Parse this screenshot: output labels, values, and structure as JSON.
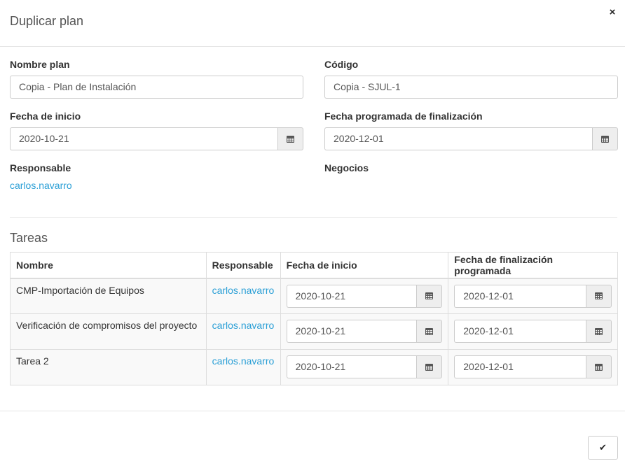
{
  "dialog": {
    "title": "Duplicar plan",
    "close_icon": "close-icon",
    "close_glyph": "×"
  },
  "form": {
    "plan_name_label": "Nombre plan",
    "plan_name_value": "Copia - Plan de Instalación",
    "code_label": "Código",
    "code_value": "Copia - SJUL-1",
    "start_date_label": "Fecha de inicio",
    "start_date_value": "2020-10-21",
    "end_date_label": "Fecha programada de finalización",
    "end_date_value": "2020-12-01",
    "responsible_label": "Responsable",
    "responsible_value": "carlos.navarro",
    "business_label": "Negocios"
  },
  "tasks": {
    "title": "Tareas",
    "columns": [
      "Nombre",
      "Responsable",
      "Fecha de inicio",
      "Fecha de finalización programada"
    ],
    "rows": [
      {
        "name": "CMP-Importación de Equipos",
        "responsible": "carlos.navarro",
        "start": "2020-10-21",
        "end": "2020-12-01"
      },
      {
        "name": "Verificación de compromisos del proyecto",
        "responsible": "carlos.navarro",
        "start": "2020-10-21",
        "end": "2020-12-01"
      },
      {
        "name": "Tarea 2",
        "responsible": "carlos.navarro",
        "start": "2020-10-21",
        "end": "2020-12-01"
      }
    ]
  },
  "footer": {
    "confirm_icon": "check-icon",
    "confirm_glyph": "✔"
  },
  "colors": {
    "link": "#2a9fd6",
    "addon_bg": "#eeeeee",
    "row_bg": "#f9f9f9"
  }
}
